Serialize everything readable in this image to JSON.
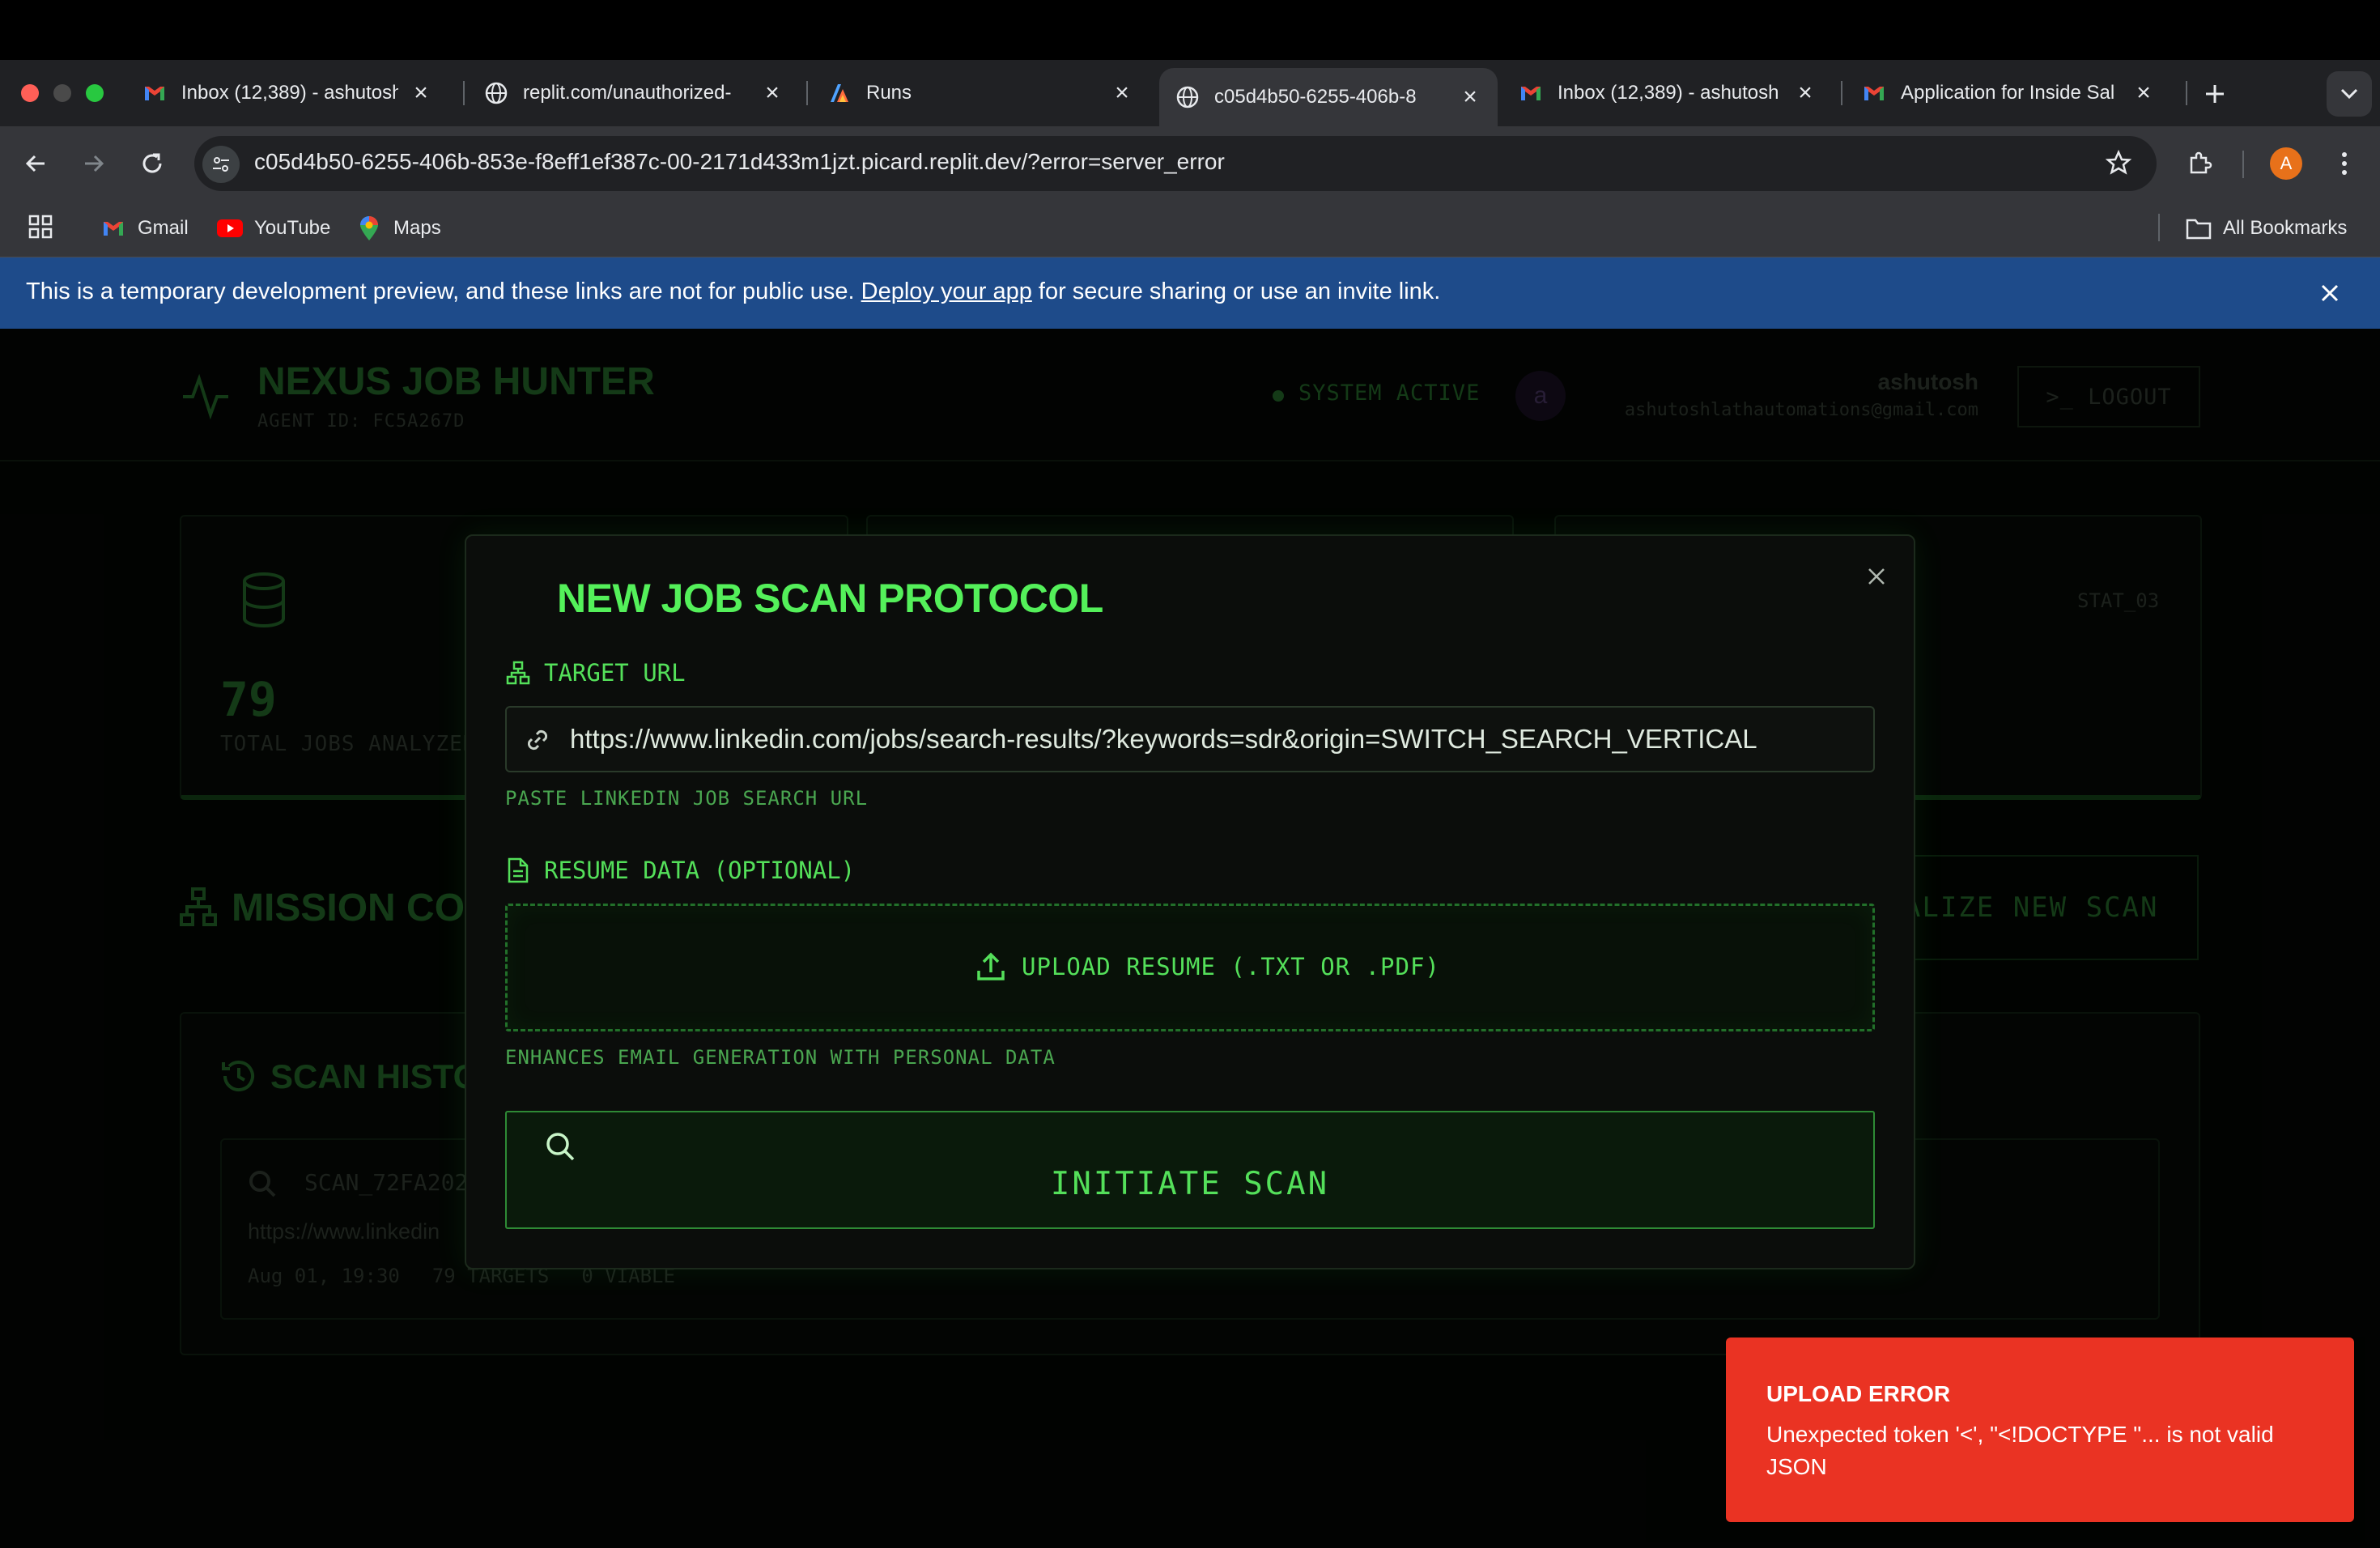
{
  "browser": {
    "tabs": [
      {
        "title": "Inbox (12,389) - ashutosh",
        "favicon": "gmail-icon"
      },
      {
        "title": "replit.com/unauthorized-",
        "favicon": "globe-icon"
      },
      {
        "title": "Runs",
        "favicon": "runs-icon"
      },
      {
        "title": "c05d4b50-6255-406b-8",
        "favicon": "globe-icon",
        "active": true
      },
      {
        "title": "Inbox (12,389) - ashutosh",
        "favicon": "gmail-icon"
      },
      {
        "title": "Application for Inside Sal",
        "favicon": "gmail-icon"
      }
    ],
    "url": "c05d4b50-6255-406b-853e-f8eff1ef387c-00-2171d433m1jzt.picard.replit.dev/?error=server_error",
    "profile_initial": "A",
    "bookmarks": [
      {
        "label": "Gmail",
        "icon": "gmail-icon"
      },
      {
        "label": "YouTube",
        "icon": "youtube-icon"
      },
      {
        "label": "Maps",
        "icon": "maps-icon"
      }
    ],
    "all_bookmarks": "All Bookmarks"
  },
  "banner": {
    "before": "This is a temporary development preview, and these links are not for public use. ",
    "link": "Deploy your app",
    "after": " for secure sharing or use an invite link."
  },
  "app": {
    "title": "NEXUS JOB HUNTER",
    "agent_id": "AGENT ID: FC5A267D",
    "status": "SYSTEM ACTIVE",
    "avatar_initial": "a",
    "user_name": "ashutosh",
    "user_email": "ashutoshlathautomations@gmail.com",
    "logout": ">_ LOGOUT",
    "stat_value": "79",
    "stat_label": "TOTAL JOBS ANALYZED",
    "stat_tag": "STAT_03",
    "section_title": "MISSION CONTROL",
    "new_scan": "INITIALIZE NEW SCAN",
    "history_title": "SCAN HISTORY",
    "history_item": {
      "id": "SCAN_72FA202",
      "url": "https://www.linkedin",
      "date": "Aug 01, 19:30",
      "targets": "79 TARGETS",
      "viable": "0 VIABLE"
    }
  },
  "modal": {
    "title": "NEW JOB SCAN PROTOCOL",
    "target_label": "TARGET URL",
    "url_value": "https://www.linkedin.com/jobs/search-results/?keywords=sdr&origin=SWITCH_SEARCH_VERTICAL",
    "url_hint": "PASTE LINKEDIN JOB SEARCH URL",
    "resume_label": "RESUME DATA (OPTIONAL)",
    "upload_label": "UPLOAD RESUME (.TXT OR .PDF)",
    "resume_hint": "ENHANCES EMAIL GENERATION WITH PERSONAL DATA",
    "scan_button": "INITIATE SCAN"
  },
  "toast": {
    "title": "UPLOAD ERROR",
    "message": "Unexpected token '<', \"<!DOCTYPE \"... is not valid JSON"
  },
  "colors": {
    "accent_green": "#54f05a",
    "toast_red": "#ea3323",
    "banner_blue": "#1e4b8a"
  }
}
